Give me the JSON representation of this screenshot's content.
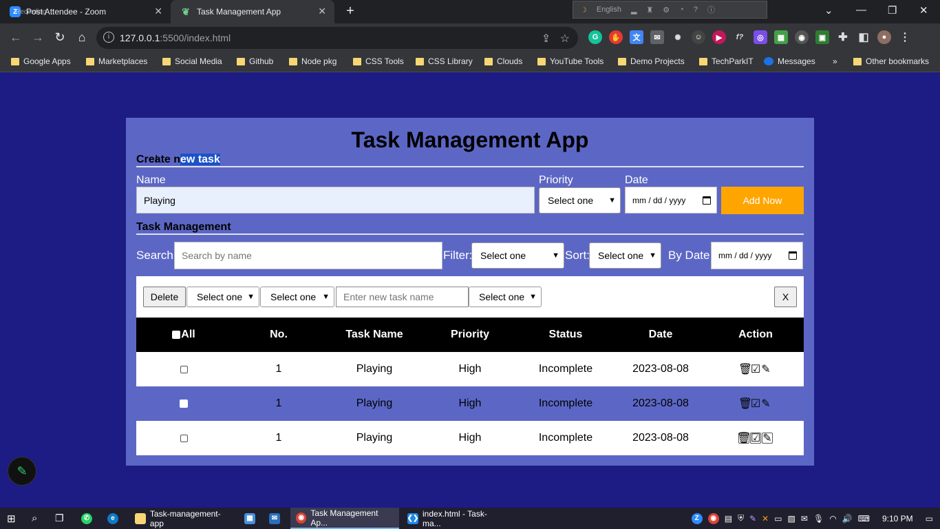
{
  "browser": {
    "tabs": [
      {
        "title": "Post Attendee - Zoom",
        "overlay": "Recording",
        "favicon": "Z",
        "active": false
      },
      {
        "title": "Task Management App",
        "favicon": "leaf-icon",
        "active": true
      }
    ],
    "ext_strip_label": "English",
    "url_host": "127.0.0.1",
    "url_path": ":5500/index.html",
    "bookmarks": [
      "Google Apps",
      "Marketplaces",
      "Social Media",
      "Github",
      "Node pkg",
      "CSS Tools",
      "CSS Library",
      "Clouds",
      "YouTube Tools",
      "Demo Projects",
      "TechParkIT",
      "Messages",
      "»",
      "Other bookmarks"
    ]
  },
  "app": {
    "title": "Task Management App",
    "create": {
      "heading_before": "Create n",
      "heading_highlight": "ew task",
      "name_label": "Name",
      "name_value": "Playing",
      "priority_label": "Priority",
      "priority_value": "Select one",
      "date_label": "Date",
      "date_placeholder": "mm / dd / yyyy",
      "add_label": "Add Now"
    },
    "management": {
      "heading": "Task Management",
      "search_label": "Search:",
      "search_placeholder": "Search by name",
      "filter_label": "Filter:",
      "filter_value": "Select one",
      "sort_label": "Sort:",
      "sort_value": "Select one",
      "bydate_label": "By Date:",
      "bydate_placeholder": "mm / dd / yyyy"
    },
    "bulk": {
      "delete_label": "Delete",
      "select1": "Select one",
      "select2": "Select one",
      "rename_placeholder": "Enter new task name",
      "select3": "Select one",
      "close_label": "X"
    },
    "table": {
      "headers": {
        "all": "All",
        "no": "No.",
        "name": "Task Name",
        "priority": "Priority",
        "status": "Status",
        "date": "Date",
        "action": "Action"
      },
      "rows": [
        {
          "no": "1",
          "name": "Playing",
          "priority": "High",
          "status": "Incomplete",
          "date": "2023-08-08"
        },
        {
          "no": "1",
          "name": "Playing",
          "priority": "High",
          "status": "Incomplete",
          "date": "2023-08-08"
        },
        {
          "no": "1",
          "name": "Playing",
          "priority": "High",
          "status": "Incomplete",
          "date": "2023-08-08"
        }
      ]
    }
  },
  "taskbar": {
    "items": [
      "Task-management-app",
      "Task Management Ap...",
      "index.html - Task-ma..."
    ],
    "time": "9:10 PM"
  },
  "colors": {
    "page_bg": "#1c1c84",
    "card_bg": "#5c67c5",
    "accent": "#ffa500",
    "table_head": "#000000"
  }
}
